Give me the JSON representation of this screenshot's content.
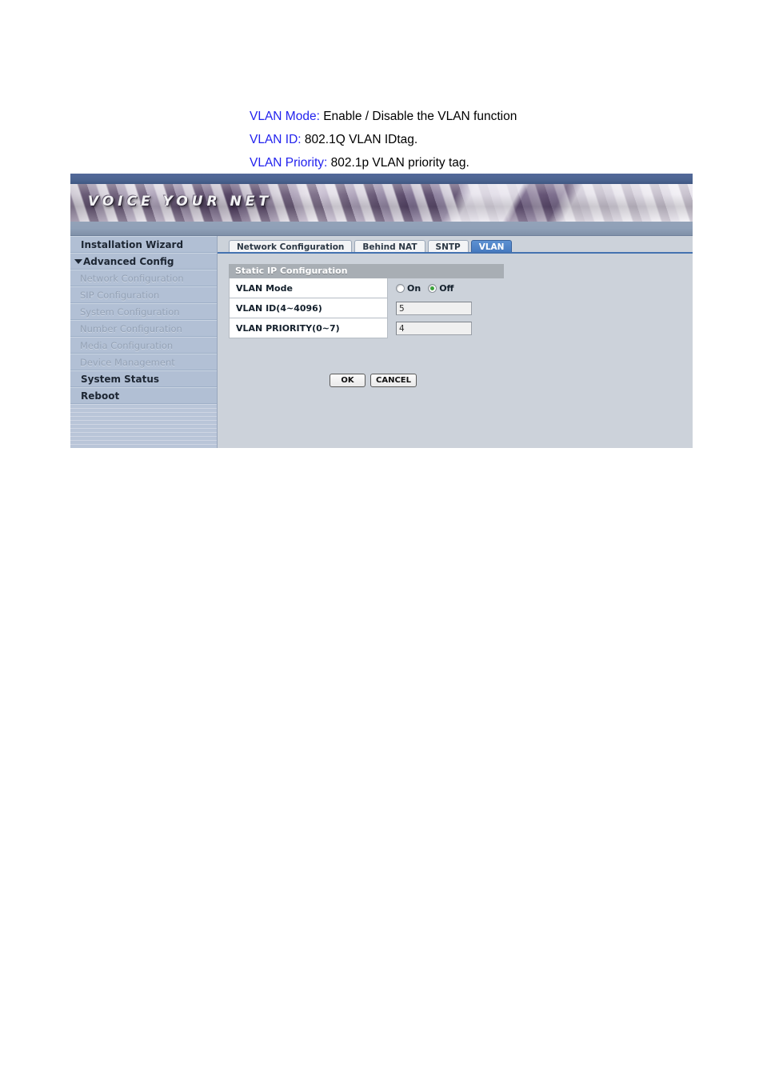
{
  "doc": {
    "lines": [
      {
        "term": "VLAN Mode:",
        "desc": " Enable / Disable the VLAN function"
      },
      {
        "term": "VLAN ID:",
        "desc": " 802.1Q VLAN IDtag."
      },
      {
        "term": "VLAN Priority:",
        "desc": " 802.1p VLAN priority tag."
      }
    ],
    "term_color": "#2222ee"
  },
  "screenshot": {
    "banner": {
      "logo_text": "VOICE YOUR NET"
    },
    "sidebar": {
      "items": [
        {
          "label": "Installation Wizard",
          "type": "top"
        },
        {
          "label": "Advanced Config",
          "type": "parent",
          "expanded": true
        },
        {
          "label": "Network Configuration",
          "type": "sub"
        },
        {
          "label": "SIP Configuration",
          "type": "sub"
        },
        {
          "label": "System Configuration",
          "type": "sub"
        },
        {
          "label": "Number Configuration",
          "type": "sub"
        },
        {
          "label": "Media Configuration",
          "type": "sub"
        },
        {
          "label": "Device Management",
          "type": "sub"
        },
        {
          "label": "System Status",
          "type": "top"
        },
        {
          "label": "Reboot",
          "type": "top"
        }
      ]
    },
    "tabs": [
      {
        "label": "Network Configuration",
        "active": false
      },
      {
        "label": "Behind NAT",
        "active": false
      },
      {
        "label": "SNTP",
        "active": false
      },
      {
        "label": "VLAN",
        "active": true
      }
    ],
    "panel": {
      "title": "Static IP Configuration",
      "rows": [
        {
          "label": "VLAN Mode",
          "control": "radio",
          "options": [
            {
              "label": "On",
              "checked": false
            },
            {
              "label": "Off",
              "checked": true
            }
          ]
        },
        {
          "label": "VLAN ID(4~4096)",
          "control": "text",
          "value": "5"
        },
        {
          "label": "VLAN PRIORITY(0~7)",
          "control": "text",
          "value": "4"
        }
      ]
    },
    "buttons": {
      "ok": "OK",
      "cancel": "CANCEL"
    },
    "colors": {
      "active_tab": "#4a80c4",
      "banner_top": "#4f6790",
      "content_bg": "#ccd2da",
      "sidebar_bg": "#b1bfd4",
      "panel_head": "#a8aeb4",
      "radio_checked": "#3aa23a"
    }
  }
}
